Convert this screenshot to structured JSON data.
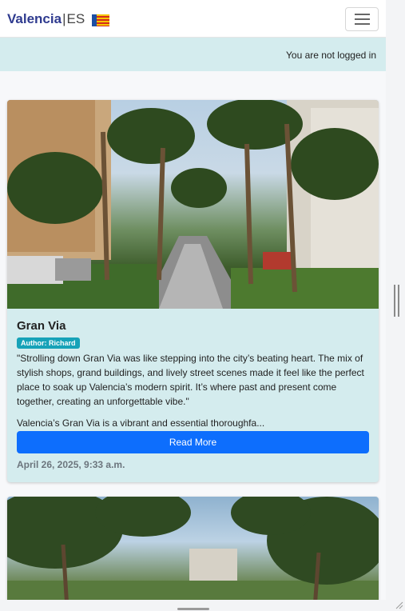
{
  "navbar": {
    "brand_name": "Valencia",
    "brand_separator": "|",
    "brand_lang": "ES",
    "flag_icon": "valencian-flag",
    "menu_icon": "hamburger-menu-icon"
  },
  "status": {
    "text": "You are not logged in"
  },
  "posts": [
    {
      "title": "Gran Via",
      "author": "Author: Richard",
      "quote": "\"Strolling down Gran Via was like stepping into the city’s beating heart. The mix of stylish shops, grand buildings, and lively street scenes made it feel like the perfect place to soak up Valencia’s modern spirit. It’s where past and present come together, creating an unforgettable vibe.\"",
      "excerpt": "Valencia’s Gran Via is a vibrant and essential thoroughfa...",
      "button_label": "Read More",
      "date": "April 26, 2025, 9:33 a.m."
    }
  ],
  "colors": {
    "brand": "#2f3b8f",
    "status_bg": "#d4ecee",
    "card_bg": "#d4ecee",
    "badge": "#16a2b8",
    "primary_button": "#0d6efd",
    "date_text": "#6c757d"
  }
}
